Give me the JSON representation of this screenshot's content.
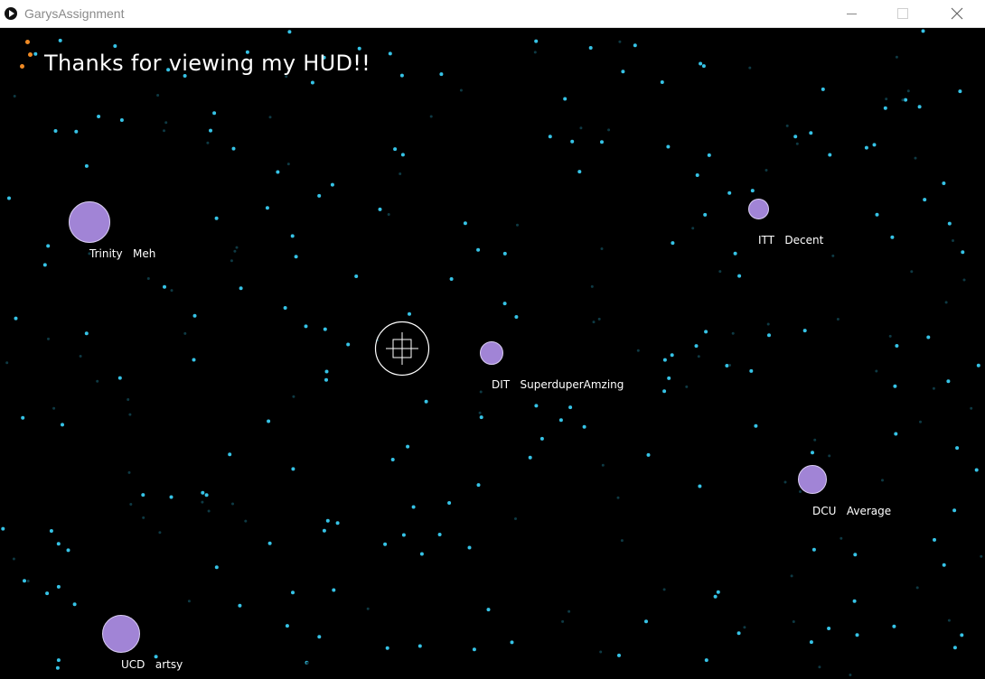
{
  "window": {
    "title": "GarysAssignment",
    "controls": [
      "minimize",
      "maximize",
      "close"
    ]
  },
  "hud": {
    "message": "Thanks for viewing my HUD!!",
    "star_color": "#36c3e6",
    "planet_color": "#a184d6"
  },
  "planets": [
    {
      "name": "Trinity",
      "rating": "Meh",
      "label": "Trinity   Meh"
    },
    {
      "name": "ITT",
      "rating": "Decent",
      "label": "ITT   Decent"
    },
    {
      "name": "DIT",
      "rating": "SuperduperAmzing",
      "label": "DIT   SuperduperAmzing"
    },
    {
      "name": "DCU",
      "rating": "Average",
      "label": "DCU   Average"
    },
    {
      "name": "UCD",
      "rating": "artsy",
      "label": "UCD   artsy"
    }
  ]
}
